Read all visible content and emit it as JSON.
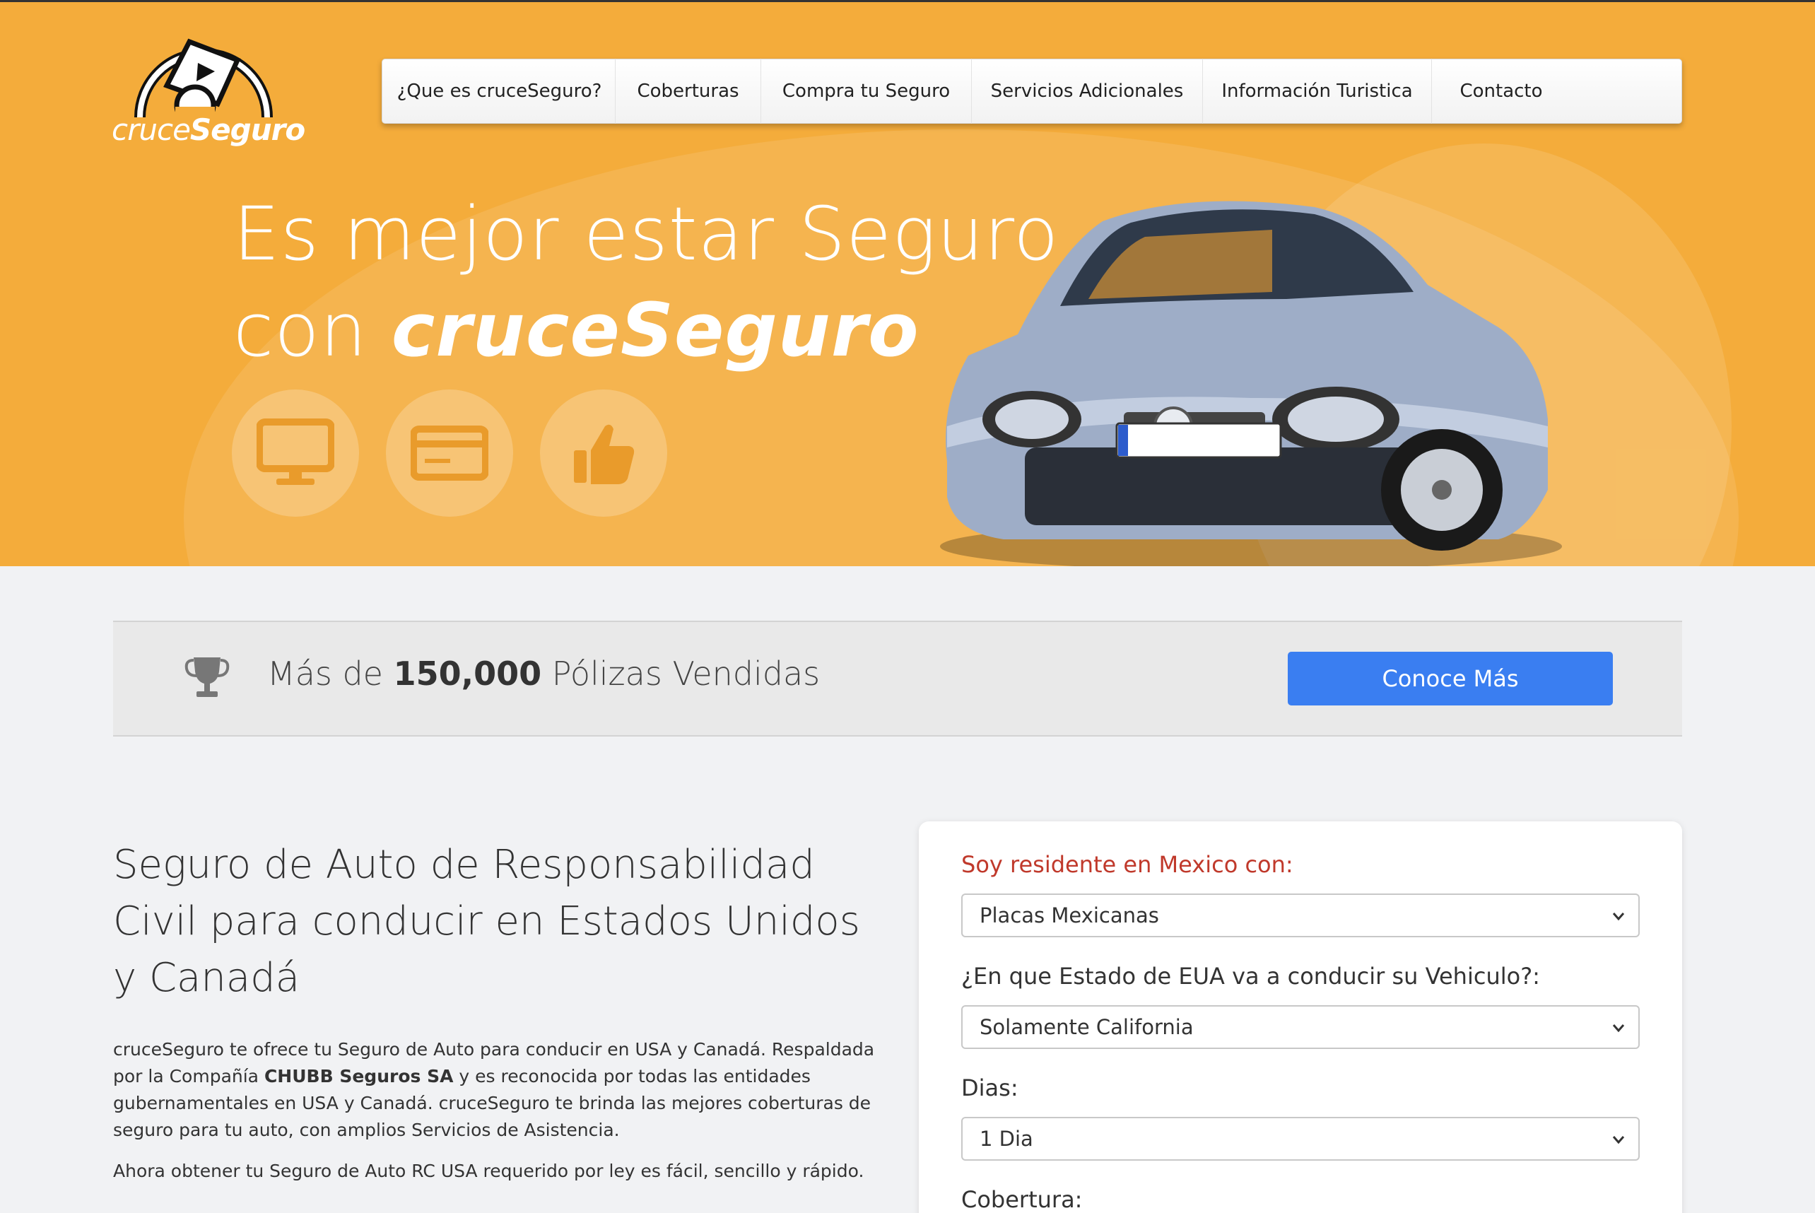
{
  "logo": {
    "word_light": "cruce",
    "word_bold": "Seguro"
  },
  "nav": {
    "items": [
      {
        "label": "¿Que es cruceSeguro?"
      },
      {
        "label": "Coberturas"
      },
      {
        "label": "Compra tu Seguro"
      },
      {
        "label": "Servicios Adicionales"
      },
      {
        "label": "Información Turistica"
      },
      {
        "label": "Contacto"
      }
    ]
  },
  "hero": {
    "line1": "Es mejor estar Seguro",
    "line2_prefix": "con ",
    "line2_brand": "cruceSeguro",
    "features": [
      "monitor-icon",
      "credit-card-icon",
      "thumbs-up-icon"
    ],
    "car_plate": ""
  },
  "stats": {
    "prefix": "Más de ",
    "count": "150,000",
    "suffix": " Pólizas Vendidas",
    "cta_label": "Conoce Más"
  },
  "main": {
    "title": "Seguro de Auto de Responsabilidad Civil para conducir en Estados Unidos y Canadá",
    "para1_a": "cruceSeguro te ofrece tu Seguro de Auto para conducir en USA y Canadá. Respaldada por la Compañía ",
    "para1_b": "CHUBB Seguros SA",
    "para1_c": " y es reconocida por todas las entidades gubernamentales en USA y Canadá. cruceSeguro te brinda las mejores coberturas de seguro para tu auto, con amplios Servicios de Asistencia.",
    "para2": "Ahora obtener tu Seguro de Auto RC USA requerido por ley es fácil, sencillo y rápido."
  },
  "form": {
    "residence_label": "Soy residente en Mexico con:",
    "residence_value": "Placas Mexicanas",
    "state_label": "¿En que Estado de EUA va a conducir su Vehiculo?:",
    "state_value": "Solamente California",
    "days_label": "Dias:",
    "days_value": "1 Dia",
    "coverage_label": "Cobertura:"
  },
  "colors": {
    "hero_bg": "#f4ac3b",
    "cta_bg": "#3a7ef1",
    "label_red": "#c0392b"
  }
}
